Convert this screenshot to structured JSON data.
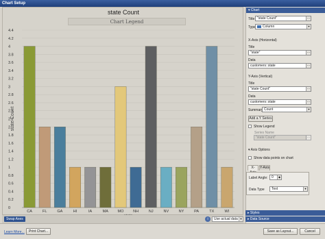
{
  "window": {
    "title": "Chart Setup"
  },
  "chart_data": {
    "type": "bar",
    "title": "state Count",
    "legend_title": "Chart Legend",
    "xlabel": "state",
    "ylabel": "state Count",
    "ylim": [
      0,
      4.4
    ],
    "yticks": [
      "0",
      "0.2",
      "0.4",
      "0.6",
      "0.8",
      "1",
      "1.2",
      "1.4",
      "1.6",
      "1.8",
      "2",
      "2.2",
      "2.4",
      "2.6",
      "2.8",
      "3",
      "3.2",
      "3.4",
      "3.6",
      "3.8",
      "4",
      "4.2",
      "4.4"
    ],
    "categories": [
      "CA",
      "FL",
      "GA",
      "HI",
      "IA",
      "MA",
      "MO",
      "NH",
      "NJ",
      "NV",
      "NY",
      "PA",
      "TX",
      "WI"
    ],
    "values": [
      4,
      2,
      2,
      1,
      1,
      1,
      3,
      1,
      4,
      1,
      1,
      2,
      4,
      1
    ],
    "colors": [
      "#8a9a35",
      "#c09a78",
      "#4a7e9c",
      "#d2a55e",
      "#949496",
      "#6f6e3a",
      "#e3c87a",
      "#3f6b94",
      "#5e5f61",
      "#6aaec3",
      "#9aa45e",
      "#b4a088",
      "#6f8fa6",
      "#c9a66e"
    ],
    "grid": true
  },
  "swap_bar": {
    "swap_label": "Swap Axes",
    "info_icon": "i",
    "actual_value": "Use actual data"
  },
  "panel": {
    "chart_section": "Chart",
    "title_label": "Title",
    "title_value": "\"state Count\"",
    "type_label": "Type",
    "type_value": "Column",
    "xaxis_header": "X-Axis (Horizontal)",
    "x_title_label": "Title",
    "x_title_value": "\"state\"",
    "x_data_label": "Data",
    "x_data_value": "customers::state",
    "yaxis_header": "Y-Axis (Vertical)",
    "y_title_label": "Title",
    "y_title_value": "\"state Count\"",
    "y_data_label": "Data",
    "y_data_value": "customers::state",
    "summary_label": "Summary",
    "summary_value": "Count",
    "add_series_label": "Add a Y Series",
    "show_legend_label": "Show Legend",
    "series_name_label": "Series Name",
    "series_name_value": "\"state Count\"",
    "axis_options_header": "Axis Options",
    "show_points_label": "Show data points on chart",
    "tab_x": "X-Axis",
    "tab_y": "Y-Axis",
    "label_angle_label": "Label Angle:",
    "label_angle_value": "0",
    "data_type_label": "Data Type",
    "data_type_value": "Text",
    "styles_section": "Styles",
    "data_source_section": "Data Source"
  },
  "footer": {
    "learn_more": "Learn More...",
    "print_label": "Print Chart...",
    "save_label": "Save as Layout...",
    "cancel_label": "Cancel"
  }
}
